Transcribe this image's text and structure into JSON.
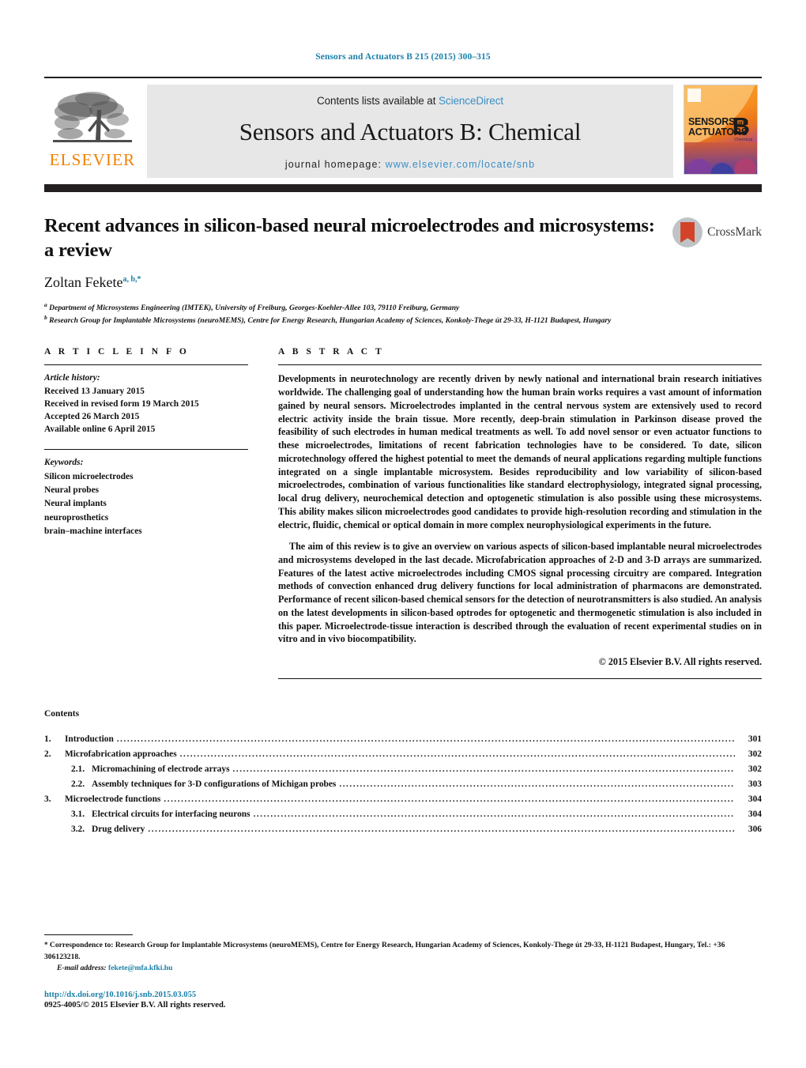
{
  "running_head": "Sensors and Actuators B 215 (2015) 300–315",
  "masthead": {
    "publisher_name": "ELSEVIER",
    "contents_prefix": "Contents lists available at ",
    "contents_link": "ScienceDirect",
    "journal_title": "Sensors and Actuators B: Chemical",
    "homepage_label": "journal homepage:",
    "homepage_url": "www.elsevier.com/locate/snb",
    "cover": {
      "line1": "SENSORS",
      "line1_small": "and",
      "line2": "ACTUATORS",
      "letter": "B",
      "sub": "Chemical"
    }
  },
  "article": {
    "title": "Recent advances in silicon-based neural microelectrodes and microsystems: a review",
    "author": "Zoltan Fekete",
    "author_marks": "a, b,",
    "author_star": "*",
    "crossmark_label": "CrossMark",
    "affiliations": [
      {
        "mark": "a",
        "text": "Department of Microsystems Engineering (IMTEK), University of Freiburg, Georges-Koehler-Allee 103, 79110 Freiburg, Germany"
      },
      {
        "mark": "b",
        "text": "Research Group for Implantable Microsystems (neuroMEMS), Centre for Energy Research, Hungarian Academy of Sciences, Konkoly-Thege út 29-33, H-1121 Budapest, Hungary"
      }
    ]
  },
  "article_info": {
    "heading": "A R T I C L E    I N F O",
    "history_label": "Article history:",
    "history": [
      "Received 13 January 2015",
      "Received in revised form 19 March 2015",
      "Accepted 26 March 2015",
      "Available online 6 April 2015"
    ],
    "keywords_label": "Keywords:",
    "keywords": [
      "Silicon microelectrodes",
      "Neural probes",
      "Neural implants",
      "neuroprosthetics",
      "brain–machine interfaces"
    ]
  },
  "abstract": {
    "heading": "A B S T R A C T",
    "paragraphs": [
      "Developments in neurotechnology are recently driven by newly national and international brain research initiatives worldwide. The challenging goal of understanding how the human brain works requires a vast amount of information gained by neural sensors. Microelectrodes implanted in the central nervous system are extensively used to record electric activity inside the brain tissue. More recently, deep-brain stimulation in Parkinson disease proved the feasibility of such electrodes in human medical treatments as well. To add novel sensor or even actuator functions to these microelectrodes, limitations of recent fabrication technologies have to be considered. To date, silicon microtechnology offered the highest potential to meet the demands of neural applications regarding multiple functions integrated on a single implantable microsystem. Besides reproducibility and low variability of silicon-based microelectrodes, combination of various functionalities like standard electrophysiology, integrated signal processing, local drug delivery, neurochemical detection and optogenetic stimulation is also possible using these microsystems. This ability makes silicon microelectrodes good candidates to provide high-resolution recording and stimulation in the electric, fluidic, chemical or optical domain in more complex neurophysiological experiments in the future.",
      "The aim of this review is to give an overview on various aspects of silicon-based implantable neural microelectrodes and microsystems developed in the last decade. Microfabrication approaches of 2-D and 3-D arrays are summarized. Features of the latest active microelectrodes including CMOS signal processing circuitry are compared. Integration methods of convection enhanced drug delivery functions for local administration of pharmacons are demonstrated. Performance of recent silicon-based chemical sensors for the detection of neurotransmitters is also studied. An analysis on the latest developments in silicon-based optrodes for optogenetic and thermogenetic stimulation is also included in this paper. Microelectrode-tissue interaction is described through the evaluation of recent experimental studies on in vitro and in vivo biocompatibility."
    ],
    "copyright": "© 2015 Elsevier B.V. All rights reserved."
  },
  "contents": {
    "title": "Contents",
    "entries": [
      {
        "num": "1.",
        "label": "Introduction",
        "page": "301",
        "level": 1
      },
      {
        "num": "2.",
        "label": "Microfabrication approaches",
        "page": "302",
        "level": 1
      },
      {
        "num": "2.1.",
        "label": "Micromachining of electrode arrays",
        "page": "302",
        "level": 2
      },
      {
        "num": "2.2.",
        "label": "Assembly techniques for 3-D configurations of Michigan probes",
        "page": "303",
        "level": 2
      },
      {
        "num": "3.",
        "label": "Microelectrode functions",
        "page": "304",
        "level": 1
      },
      {
        "num": "3.1.",
        "label": "Electrical circuits for interfacing neurons",
        "page": "304",
        "level": 2
      },
      {
        "num": "3.2.",
        "label": "Drug delivery",
        "page": "306",
        "level": 2
      }
    ]
  },
  "footer": {
    "correspondence_star": "*",
    "correspondence": "Correspondence to: Research Group for Implantable Microsystems (neuroMEMS), Centre for Energy Research, Hungarian Academy of Sciences, Konkoly-Thege út 29-33, H-1121 Budapest, Hungary, Tel.: +36 306123218.",
    "email_label": "E-mail address:",
    "email": "fekete@mfa.kfki.hu",
    "doi": "http://dx.doi.org/10.1016/j.snb.2015.03.055",
    "issn_line": "0925-4005/© 2015 Elsevier B.V. All rights reserved."
  },
  "colors": {
    "link_blue": "#1a7fa8",
    "sd_blue": "#3a8fc4",
    "elsevier_orange": "#f08000",
    "masthead_grey": "#e7e7e8",
    "rule_black": "#231f20"
  }
}
